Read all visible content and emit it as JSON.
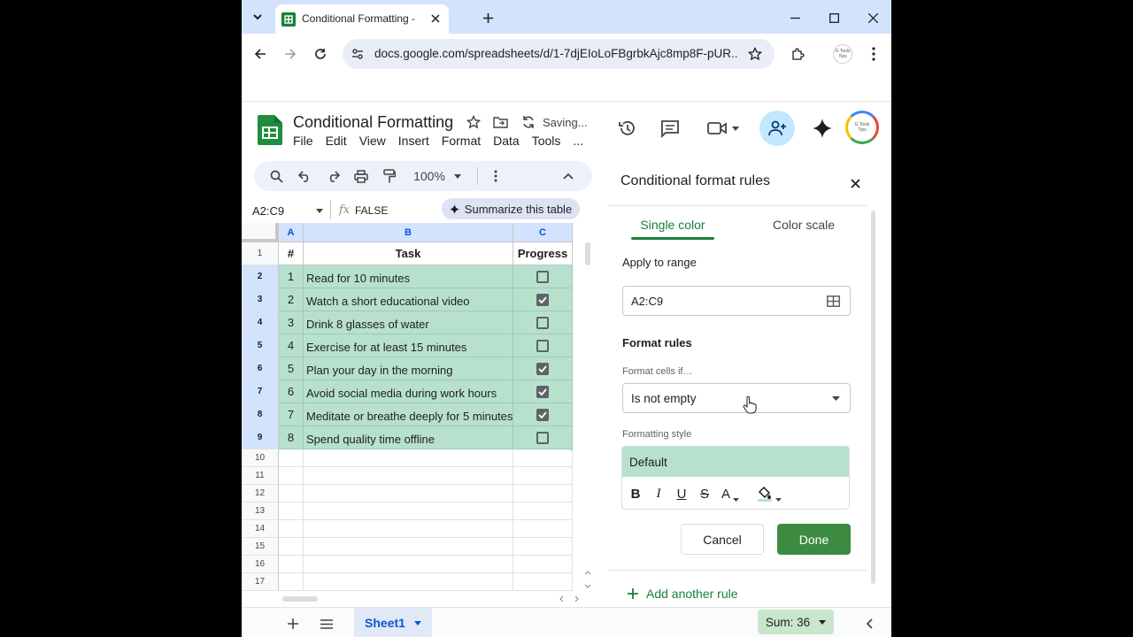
{
  "browser": {
    "tab_title": "Conditional Formatting - Google Sheets",
    "url": "docs.google.com/spreadsheets/d/1-7djEIoLoFBgrbkAjc8mp8F-pUR...",
    "profile_label": "G Tools Tips"
  },
  "doc": {
    "title": "Conditional Formatting",
    "save_status": "Saving...",
    "menus": [
      "File",
      "Edit",
      "View",
      "Insert",
      "Format",
      "Data",
      "Tools",
      "..."
    ]
  },
  "toolbar": {
    "zoom": "100%"
  },
  "formula_bar": {
    "name_box": "A2:C9",
    "fx": "fx",
    "value": "FALSE",
    "summarize_label": "Summarize this table"
  },
  "grid": {
    "columns": [
      "A",
      "B",
      "C"
    ],
    "row_numbers": [
      "1",
      "2",
      "3",
      "4",
      "5",
      "6",
      "7",
      "8",
      "9",
      "10",
      "11",
      "12",
      "13",
      "14",
      "15",
      "16",
      "17"
    ],
    "header": {
      "a": "#",
      "b": "Task",
      "c": "Progress"
    },
    "rows": [
      {
        "num": "1",
        "task": "Read for 10 minutes",
        "done": false
      },
      {
        "num": "2",
        "task": "Watch a short educational video",
        "done": true
      },
      {
        "num": "3",
        "task": "Drink 8 glasses of water",
        "done": false
      },
      {
        "num": "4",
        "task": "Exercise for at least 15 minutes",
        "done": false
      },
      {
        "num": "5",
        "task": "Plan your day in the morning",
        "done": true
      },
      {
        "num": "6",
        "task": "Avoid social media during work hours",
        "done": true
      },
      {
        "num": "7",
        "task": "Meditate or breathe deeply for 5 minutes",
        "done": true
      },
      {
        "num": "8",
        "task": "Spend quality time offline",
        "done": false
      }
    ]
  },
  "panel": {
    "title": "Conditional format rules",
    "tab_single": "Single color",
    "tab_scale": "Color scale",
    "apply_label": "Apply to range",
    "range_value": "A2:C9",
    "rules_label": "Format rules",
    "cells_if_label": "Format cells if…",
    "condition": "Is not empty",
    "style_label": "Formatting style",
    "style_preview": "Default",
    "fmt_buttons": {
      "bold": "B",
      "italic": "I",
      "underline": "U",
      "strike": "S",
      "text_color": "A"
    },
    "cancel": "Cancel",
    "done": "Done",
    "add_rule": "Add another rule"
  },
  "bottom": {
    "sheet_tab": "Sheet1",
    "sum": "Sum: 36"
  },
  "colors": {
    "accent_green": "#188038",
    "done_button": "#3d8b40",
    "fill_green": "#b7e1cd",
    "selection_blue": "#1a73e8"
  }
}
